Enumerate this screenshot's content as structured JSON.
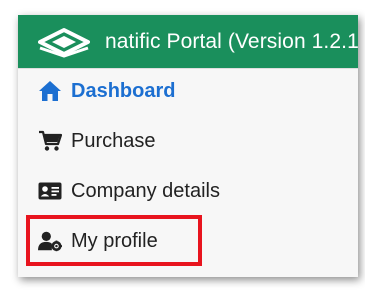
{
  "header": {
    "app_title": "natific Portal (Version 1.2.1.",
    "logo_icon": "natific-logo-icon"
  },
  "colors": {
    "header_bg": "#1a8f5c",
    "active_link": "#1c6fd1",
    "highlight_border": "#e8141e"
  },
  "menu": {
    "items": [
      {
        "label": "Dashboard",
        "icon": "home-icon",
        "active": true
      },
      {
        "label": "Purchase",
        "icon": "shopping-cart-icon",
        "active": false
      },
      {
        "label": "Company details",
        "icon": "id-card-icon",
        "active": false
      },
      {
        "label": "My profile",
        "icon": "user-cog-icon",
        "active": false
      }
    ]
  }
}
